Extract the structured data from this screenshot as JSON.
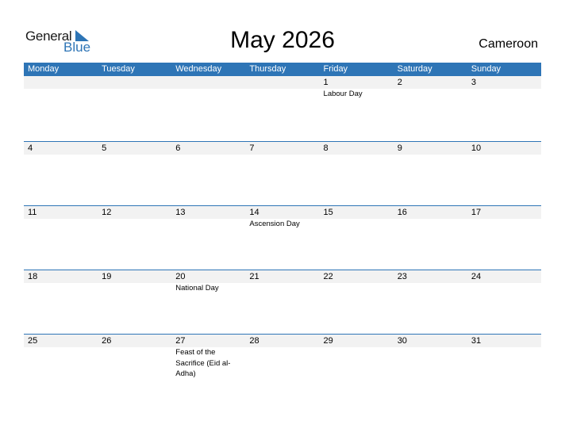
{
  "logo": {
    "general": "General",
    "blue": "Blue"
  },
  "title": "May 2026",
  "country": "Cameroon",
  "colors": {
    "accent": "#2e75b6",
    "band": "#f2f2f2"
  },
  "days": [
    "Monday",
    "Tuesday",
    "Wednesday",
    "Thursday",
    "Friday",
    "Saturday",
    "Sunday"
  ],
  "weeks": [
    [
      {
        "d": ""
      },
      {
        "d": ""
      },
      {
        "d": ""
      },
      {
        "d": ""
      },
      {
        "d": "1",
        "e": "Labour Day"
      },
      {
        "d": "2"
      },
      {
        "d": "3"
      }
    ],
    [
      {
        "d": "4"
      },
      {
        "d": "5"
      },
      {
        "d": "6"
      },
      {
        "d": "7"
      },
      {
        "d": "8"
      },
      {
        "d": "9"
      },
      {
        "d": "10"
      }
    ],
    [
      {
        "d": "11"
      },
      {
        "d": "12"
      },
      {
        "d": "13"
      },
      {
        "d": "14",
        "e": "Ascension Day"
      },
      {
        "d": "15"
      },
      {
        "d": "16"
      },
      {
        "d": "17"
      }
    ],
    [
      {
        "d": "18"
      },
      {
        "d": "19"
      },
      {
        "d": "20",
        "e": "National Day"
      },
      {
        "d": "21"
      },
      {
        "d": "22"
      },
      {
        "d": "23"
      },
      {
        "d": "24"
      }
    ],
    [
      {
        "d": "25"
      },
      {
        "d": "26"
      },
      {
        "d": "27",
        "e": "Feast of the Sacrifice (Eid al-Adha)"
      },
      {
        "d": "28"
      },
      {
        "d": "29"
      },
      {
        "d": "30"
      },
      {
        "d": "31"
      }
    ]
  ]
}
